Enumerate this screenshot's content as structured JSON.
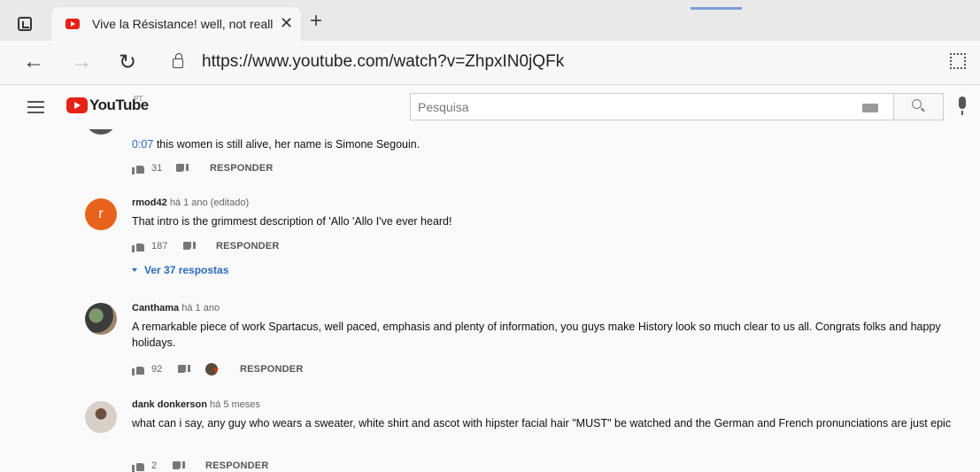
{
  "browser": {
    "tab_title": "Vive la Résistance! well, not reall",
    "tab_close": "✕",
    "new_tab": "+",
    "url": "https://www.youtube.com/watch?v=ZhpxIN0jQFk"
  },
  "header": {
    "logo_text": "YouTube",
    "region": "PT",
    "search_placeholder": "Pesquisa"
  },
  "comments": [
    {
      "timestamp_link": "0:07",
      "text": " this women is still alive, her name is Simone Segouin.",
      "likes": "31",
      "reply_label": "RESPONDER"
    },
    {
      "author": "rmod42",
      "meta": "há 1 ano (editado)",
      "avatar_letter": "r",
      "avatar_color": "#e8621c",
      "text": "That intro is the grimmest description of 'Allo 'Allo I've ever heard!",
      "likes": "187",
      "reply_label": "RESPONDER",
      "replies_label": "Ver 37 respostas"
    },
    {
      "author": "Canthama",
      "meta": "há 1 ano",
      "text": "A remarkable piece of work Spartacus, well paced, emphasis and plenty of information, you guys make History look so much clear to us all. Congrats folks and happy holidays.",
      "likes": "92",
      "reply_label": "RESPONDER"
    },
    {
      "author": "dank donkerson",
      "meta": "há 5 meses",
      "text": "what can i say, any guy who wears a sweater, white shirt and ascot with hipster facial hair \"MUST\" be watched and the German and French  pronunciations are just epic",
      "likes": "2",
      "reply_label": "RESPONDER"
    }
  ]
}
